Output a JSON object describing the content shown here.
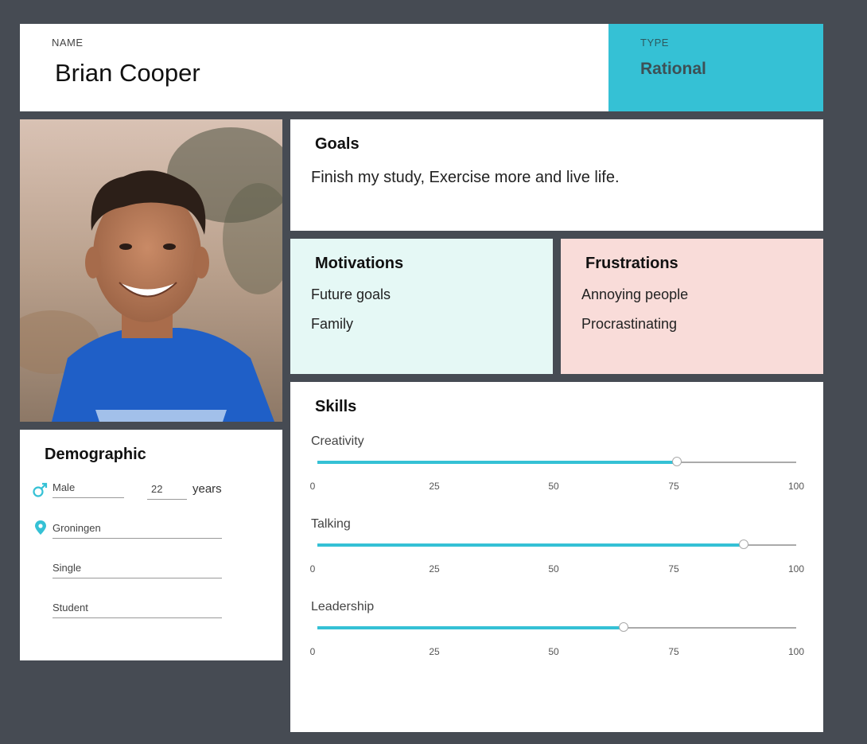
{
  "header": {
    "name_caption": "NAME",
    "name": "Brian Cooper",
    "type_caption": "TYPE",
    "type": "Rational"
  },
  "demographic": {
    "title": "Demographic",
    "gender": "Male",
    "age": "22",
    "age_unit": "years",
    "location": "Groningen",
    "relationship": "Single",
    "occupation": "Student"
  },
  "goals": {
    "title": "Goals",
    "text": "Finish my study, Exercise more and live life."
  },
  "motivations": {
    "title": "Motivations",
    "items": [
      "Future goals",
      "Family"
    ]
  },
  "frustrations": {
    "title": "Frustrations",
    "items": [
      "Annoying people",
      "Procrastinating"
    ]
  },
  "skills": {
    "title": "Skills",
    "scale_min": 0,
    "scale_max": 100,
    "ticks": [
      "0",
      "25",
      "50",
      "75",
      "100"
    ],
    "items": [
      {
        "label": "Creativity",
        "value": 75
      },
      {
        "label": "Talking",
        "value": 89
      },
      {
        "label": "Leadership",
        "value": 64
      }
    ]
  },
  "colors": {
    "accent": "#35c1d5",
    "background": "#464b53",
    "motivations_bg": "#e5f8f5",
    "frustrations_bg": "#f9dcd9"
  },
  "icons": {
    "gender": "male-symbol-icon",
    "location": "map-pin-icon"
  }
}
